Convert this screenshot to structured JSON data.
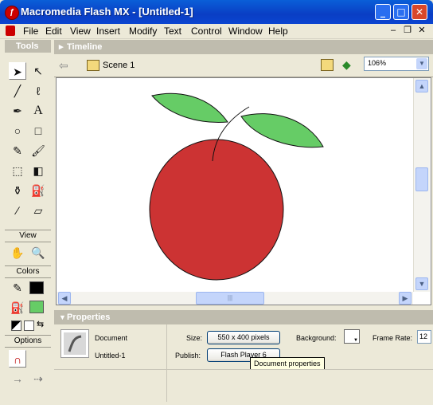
{
  "window": {
    "title": "Macromedia Flash MX - [Untitled-1]"
  },
  "menu": [
    "File",
    "Edit",
    "View",
    "Insert",
    "Modify",
    "Text",
    "Control",
    "Window",
    "Help"
  ],
  "tools_panel": {
    "title": "Tools",
    "sections": {
      "view": "View",
      "colors": "Colors",
      "options": "Options"
    }
  },
  "timeline": {
    "title": "Timeline"
  },
  "scene": {
    "label": "Scene 1",
    "zoom": "106%"
  },
  "properties": {
    "title": "Properties",
    "doc_type": "Document",
    "doc_name": "Untitled-1",
    "size_label": "Size:",
    "size_value": "550 x 400 pixels",
    "background_label": "Background:",
    "frame_rate_label": "Frame Rate:",
    "frame_rate_value": "12",
    "publish_label": "Publish:",
    "publish_value": "Flash Player 6",
    "tooltip": "Document properties"
  },
  "colors": {
    "stroke": "#000000",
    "fill": "#66cc66",
    "apple": "#cc3333",
    "leaf": "#66cc66",
    "accent": "#0a3ec4"
  }
}
